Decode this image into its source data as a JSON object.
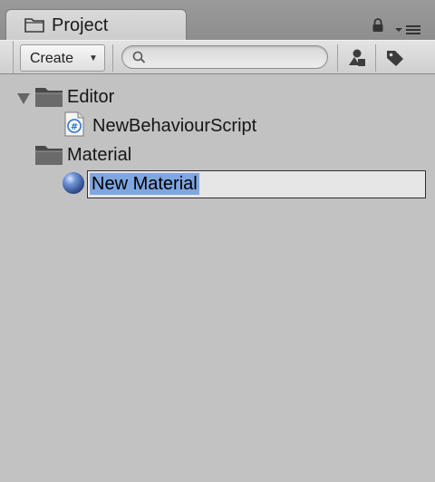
{
  "panel": {
    "tab_title": "Project",
    "tab_icon": "folder-icon",
    "lock_icon": "lock-icon",
    "menu_icon": "panel-menu-icon"
  },
  "toolbar": {
    "create_label": "Create",
    "create_arrow": "▼",
    "search": {
      "value": "",
      "placeholder": ""
    },
    "filter_by_type_icon": "filter-by-type-icon",
    "filter_by_label_icon": "label-tag-icon"
  },
  "tree": {
    "items": [
      {
        "label": "Editor",
        "icon": "folder-icon",
        "depth": 0,
        "expanded": true
      },
      {
        "label": "NewBehaviourScript",
        "icon": "csharp-script-icon",
        "depth": 1
      },
      {
        "label": "Material",
        "icon": "folder-icon",
        "depth": 0,
        "expanded": false
      },
      {
        "label": "New Material",
        "icon": "material-sphere-icon",
        "depth": 1,
        "renaming": true
      }
    ]
  },
  "colors": {
    "background": "#c2c2c2",
    "selection": "#7fa6e0",
    "toolbar": "#dcdcdc"
  }
}
